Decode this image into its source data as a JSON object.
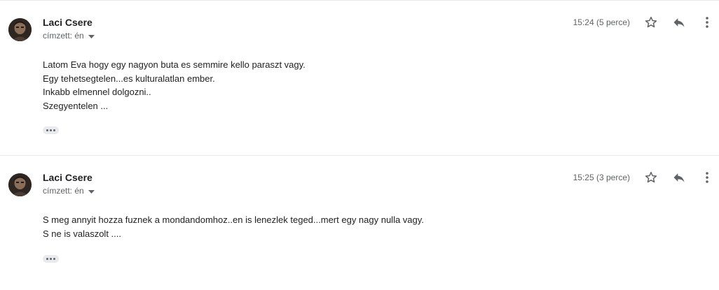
{
  "messages": [
    {
      "sender": "Laci Csere",
      "recipient": "címzett: én",
      "time": "15:24 (5 perce)",
      "lines": [
        "Latom Eva hogy egy nagyon buta es semmire kello paraszt vagy.",
        "Egy tehetsegtelen...es kulturalatlan ember.",
        "Inkabb elmennel dolgozni..",
        "Szegyentelen ..."
      ]
    },
    {
      "sender": "Laci Csere",
      "recipient": "címzett: én",
      "time": "15:25 (3 perce)",
      "lines": [
        "S meg annyit hozza fuznek a mondandomhoz..en is lenezlek teged...mert egy nagy nulla vagy.",
        "S ne is valaszolt ...."
      ]
    }
  ],
  "icons": {
    "star": "star-icon",
    "reply": "reply-icon",
    "more": "more-vert-icon",
    "caret": "caret-down-icon",
    "expand": "more-horiz-icon"
  },
  "colors": {
    "text": "#202124",
    "secondary": "#5f6368",
    "body": "#222222",
    "divider": "#e8e8e8",
    "chip": "#e8eaed"
  }
}
